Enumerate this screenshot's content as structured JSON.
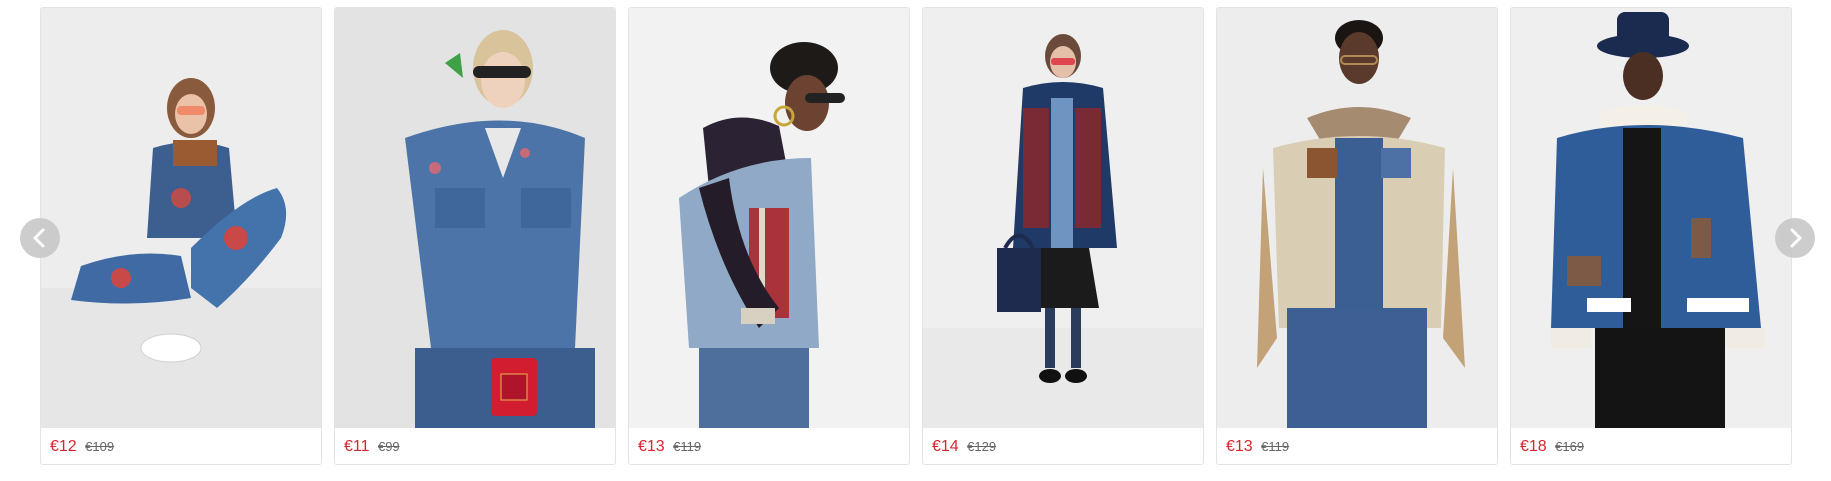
{
  "carousel": {
    "prev_icon": "chevron-left-icon",
    "next_icon": "chevron-right-icon",
    "products": [
      {
        "price": "€12",
        "old_price": "€109",
        "image": "model sitting in embroidered denim jacket and jeans"
      },
      {
        "price": "€11",
        "old_price": "€99",
        "image": "model in embroidered denim jacket holding red purse"
      },
      {
        "price": "€13",
        "old_price": "€119",
        "image": "model in denim vest with hooded top"
      },
      {
        "price": "€14",
        "old_price": "€129",
        "image": "model in patterned denim coat with tote bag"
      },
      {
        "price": "€13",
        "old_price": "€119",
        "image": "model in embroidered patchwork jacket with fur collar"
      },
      {
        "price": "€18",
        "old_price": "€169",
        "image": "model in dark denim jacket with shearling collar and bucket hat"
      }
    ]
  },
  "colors": {
    "price": "#d7262f",
    "old_price": "#666666",
    "card_border": "#e3e3e3",
    "arrow_bg": "#c8c8c8"
  }
}
